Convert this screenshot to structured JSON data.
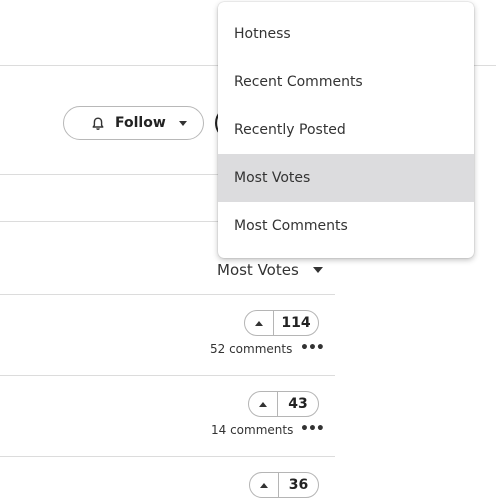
{
  "header": {
    "follow_label": "Follow"
  },
  "sort": {
    "current": "Most Votes",
    "options": [
      "Hotness",
      "Recent Comments",
      "Recently Posted",
      "Most Votes",
      "Most Comments"
    ],
    "selected_index": 3
  },
  "posts": [
    {
      "votes": "114",
      "comments": "52 comments"
    },
    {
      "votes": "43",
      "comments": "14 comments"
    },
    {
      "votes": "36",
      "comments": ""
    }
  ],
  "icons": {
    "follow": "bell-icon",
    "follow_caret": "caret-down-icon",
    "upvote": "caret-up-icon",
    "more": "ellipsis-icon"
  },
  "colors": {
    "selected_bg": "#dcdcde",
    "border": "#b5b5b5"
  }
}
